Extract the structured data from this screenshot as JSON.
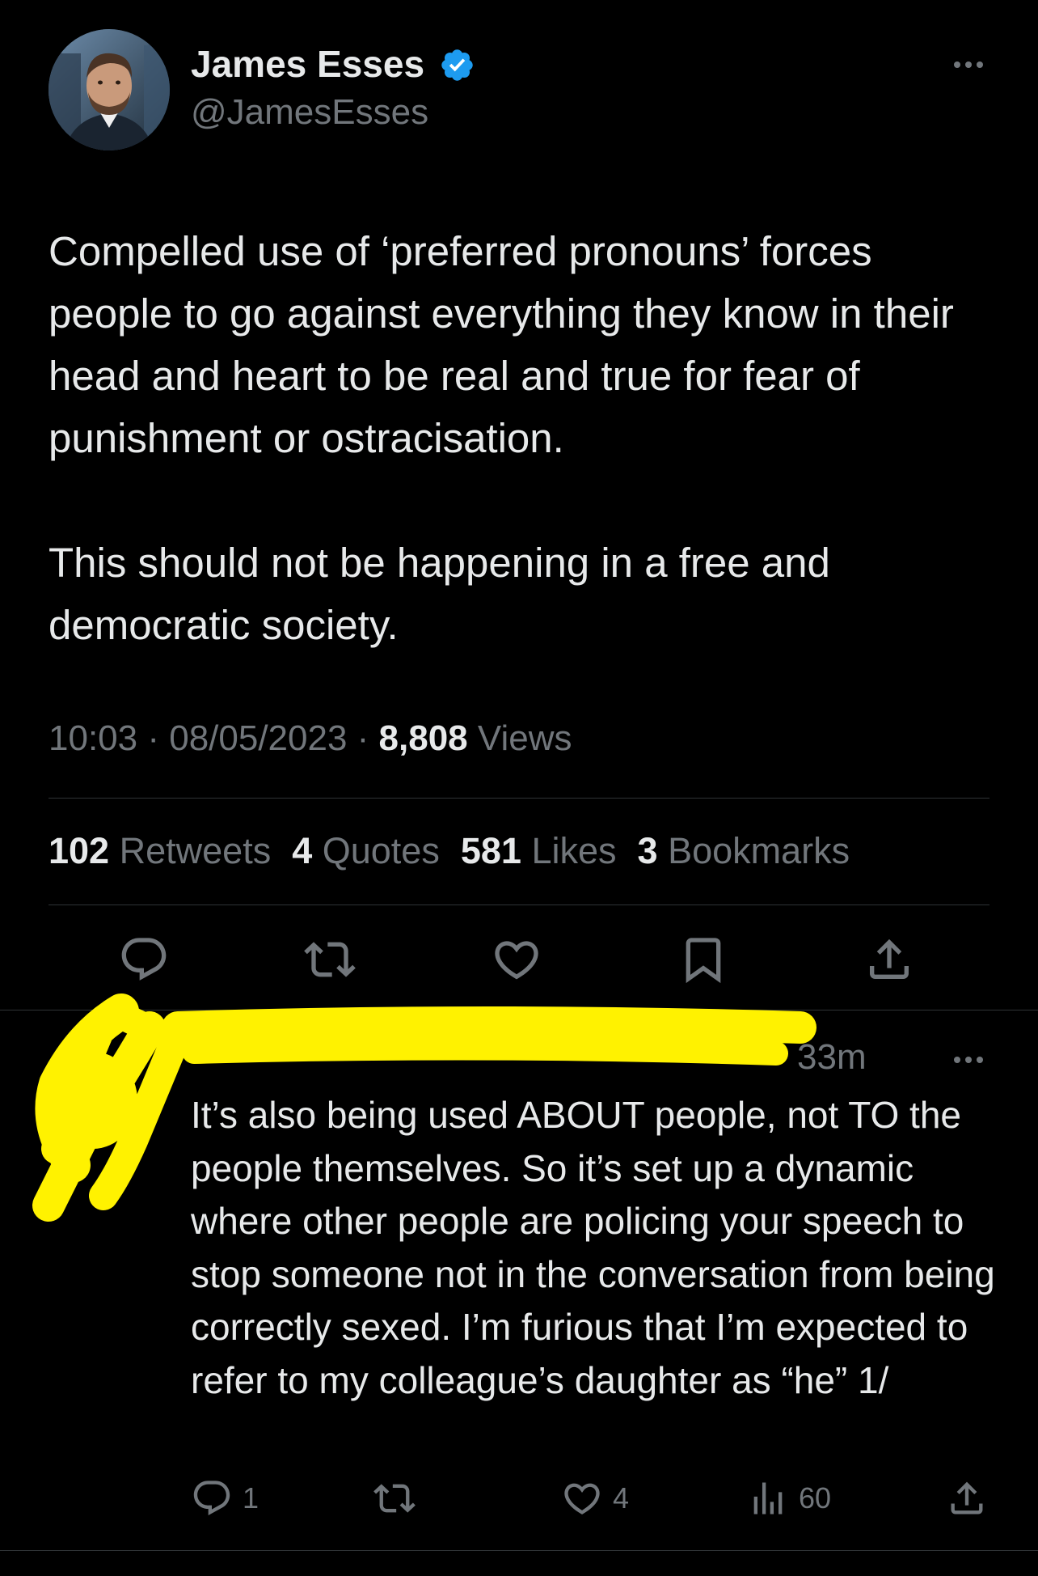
{
  "tweet": {
    "author_name": "James Esses",
    "author_handle": "@JamesEsses",
    "verified": true,
    "text": "Compelled use of ‘preferred pronouns’ forces people to go against everything they know in their head and heart to be real and true for fear of punishment or ostracisation.\n\nThis should not be happening in a free and democratic society.",
    "time": "10:03",
    "date": "08/05/2023",
    "views_count": "8,808",
    "views_label": "Views",
    "stats": {
      "retweets_count": "102",
      "retweets_label": "Retweets",
      "quotes_count": "4",
      "quotes_label": "Quotes",
      "likes_count": "581",
      "likes_label": "Likes",
      "bookmarks_count": "3",
      "bookmarks_label": "Bookmarks"
    },
    "actions": [
      "reply-icon",
      "retweet-icon",
      "like-icon",
      "bookmark-icon",
      "share-icon"
    ]
  },
  "reply": {
    "author_redacted": true,
    "time": "33m",
    "text": "It’s also being used ABOUT people, not TO the people themselves. So it’s set up a dynamic where other people are policing your speech to stop someone not in the conversation from being correctly sexed. I’m furious that I’m expected to refer to my colleague’s daughter as “he” 1/",
    "reply_count": "1",
    "like_count": "4",
    "view_count": "60"
  },
  "colors": {
    "background": "#000000",
    "text_primary": "#e7e9ea",
    "text_secondary": "#71767b",
    "divider": "#2f3336",
    "verified_blue": "#1d9bf0",
    "redaction_yellow": "#fff200"
  }
}
